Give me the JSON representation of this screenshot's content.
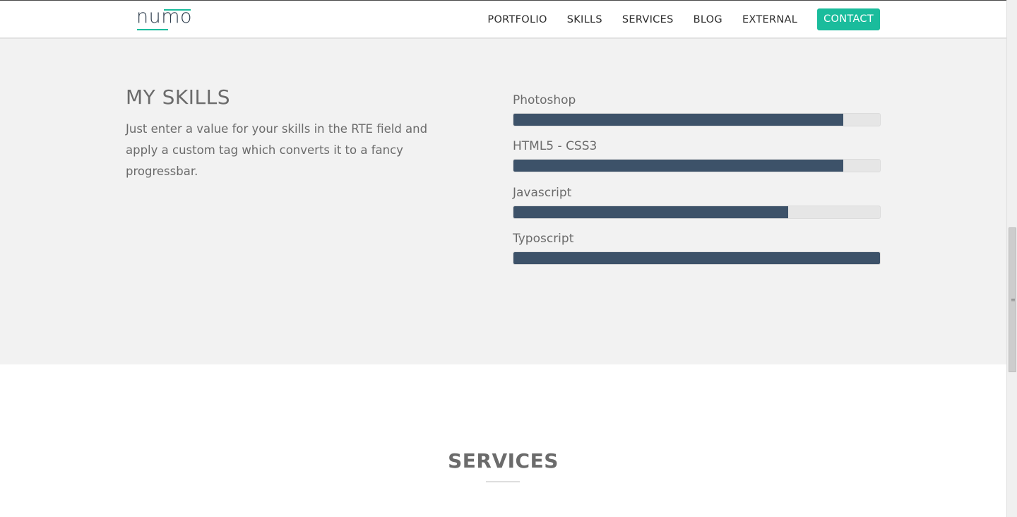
{
  "header": {
    "logo_text": "numo",
    "nav": [
      "PORTFOLIO",
      "SKILLS",
      "SERVICES",
      "BLOG",
      "EXTERNAL"
    ],
    "contact_label": "CONTACT",
    "accent_color": "#1abc9c"
  },
  "skills": {
    "title": "MY SKILLS",
    "description": "Just enter a value for your skills in the RTE field and apply a custom tag which converts it to a fancy progressbar.",
    "bar_color": "#3d5269",
    "items": [
      {
        "label": "Photoshop",
        "value": 90
      },
      {
        "label": "HTML5 - CSS3",
        "value": 90
      },
      {
        "label": "Javascript",
        "value": 75
      },
      {
        "label": "Typoscript",
        "value": 100
      }
    ]
  },
  "services": {
    "title": "SERVICES"
  }
}
